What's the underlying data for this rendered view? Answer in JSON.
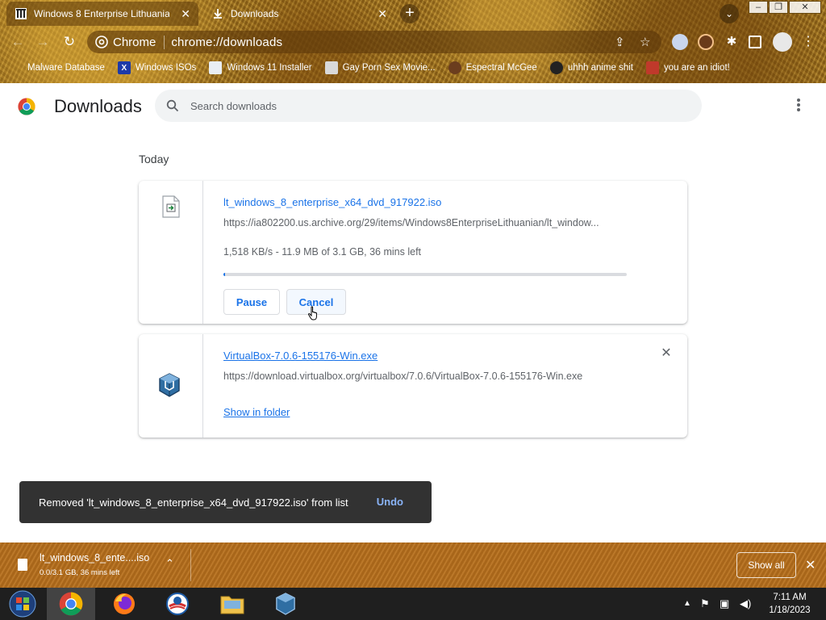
{
  "tabs": [
    {
      "title": "Windows 8 Enterprise Lithuanian",
      "icon": "archive-icon",
      "active": true
    },
    {
      "title": "Downloads",
      "icon": "download-icon",
      "active": false
    }
  ],
  "toolbar": {
    "chip_label": "Chrome",
    "url": "chrome://downloads"
  },
  "bookmarks": [
    {
      "label": "Malware Database"
    },
    {
      "label": "Windows ISOs"
    },
    {
      "label": "Windows 11 Installer"
    },
    {
      "label": "Gay Porn Sex Movie..."
    },
    {
      "label": "Espectral McGee"
    },
    {
      "label": "uhhh anime shit"
    },
    {
      "label": "you are an idiot!"
    }
  ],
  "page": {
    "title": "Downloads",
    "search_placeholder": "Search downloads",
    "section_label": "Today"
  },
  "downloads": [
    {
      "filename": "lt_windows_8_enterprise_x64_dvd_917922.iso",
      "url": "https://ia802200.us.archive.org/29/items/Windows8EnterpriseLithuanian/lt_window...",
      "status": "1,518 KB/s - 11.9 MB of 3.1 GB, 36 mins left",
      "progress": 0.004,
      "pause_label": "Pause",
      "cancel_label": "Cancel"
    },
    {
      "filename": "VirtualBox-7.0.6-155176-Win.exe",
      "url": "https://download.virtualbox.org/virtualbox/7.0.6/VirtualBox-7.0.6-155176-Win.exe",
      "action_label": "Show in folder"
    }
  ],
  "toast": {
    "message": "Removed 'lt_windows_8_enterprise_x64_dvd_917922.iso' from list",
    "undo_label": "Undo"
  },
  "shelf": {
    "filename": "lt_windows_8_ente....iso",
    "status": "0.0/3.1 GB, 36 mins left",
    "show_all_label": "Show all"
  },
  "taskbar": {
    "time": "7:11 AM",
    "date": "1/18/2023"
  },
  "colors": {
    "accent": "#1a73e8",
    "toast_bg": "#323232",
    "shelf_bg": "#b26d1e"
  }
}
